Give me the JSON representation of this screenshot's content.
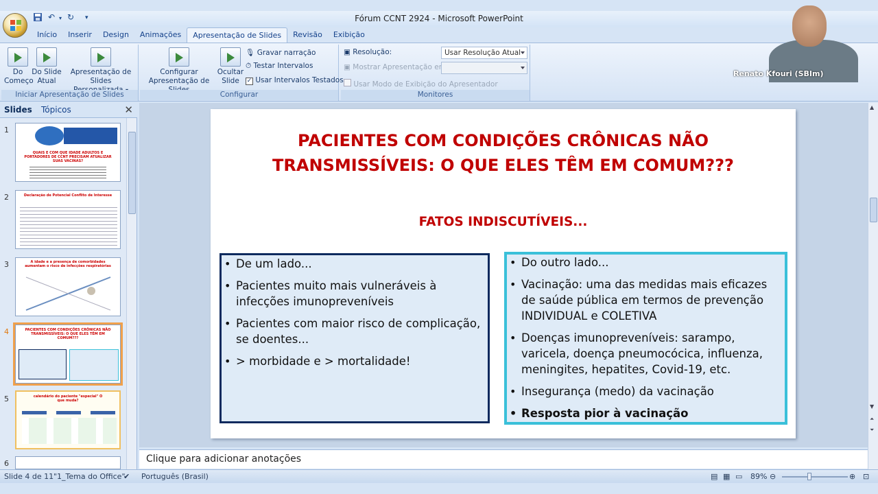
{
  "window": {
    "title": "Fórum CCNT 2924 - Microsoft PowerPoint"
  },
  "ribbon_tabs": [
    "Início",
    "Inserir",
    "Design",
    "Animações",
    "Apresentação de Slides",
    "Revisão",
    "Exibição"
  ],
  "ribbon": {
    "groups": {
      "start": {
        "label": "Iniciar Apresentação de Slides",
        "from_start_1": "Do",
        "from_start_2": "Começo",
        "from_current_1": "Do Slide",
        "from_current_2": "Atual",
        "custom_1": "Apresentação de",
        "custom_2": "Slides Personalizada"
      },
      "setup": {
        "label": "Configurar",
        "configure_1": "Configurar",
        "configure_2": "Apresentação de Slides",
        "hide_1": "Ocultar",
        "hide_2": "Slide",
        "record": "Gravar narração",
        "rehearse": "Testar Intervalos",
        "use_timings": "Usar Intervalos Testados"
      },
      "monitors": {
        "label": "Monitores",
        "resolution_label": "Resolução:",
        "resolution_value": "Usar Resolução Atual",
        "show_on_label": "Mostrar Apresentação em:",
        "presenter_view": "Usar Modo de Exibição do Apresentador"
      }
    }
  },
  "left_pane": {
    "tabs": [
      "Slides",
      "Tópicos"
    ],
    "thumbnails": [
      {
        "num": "1",
        "text": "QUAIS E COM QUE IDADE ADULTOS E PORTADORES DE CCNT PRECISAM ATUALIZAR SUAS VACINAS?"
      },
      {
        "num": "2",
        "text": "Declaração de Potencial Conflito de Interesse"
      },
      {
        "num": "3",
        "text": "A idade e a presença de comorbidades aumentam o risco de infecções respiratórias"
      },
      {
        "num": "4",
        "text": "PACIENTES COM CONDIÇÕES CRÔNICAS NÃO TRANSMISSÍVEIS: O QUE ELES TÊM EM COMUM???"
      },
      {
        "num": "5",
        "text": "calendário do paciente \"especial\" O que muda?"
      },
      {
        "num": "6",
        "text": ""
      }
    ]
  },
  "slide": {
    "title_line1": "PACIENTES COM CONDIÇÕES CRÔNICAS NÃO",
    "title_line2": "TRANSMISSÍVEIS: O QUE ELES TÊM EM COMUM???",
    "subtitle": "FATOS INDISCUTÍVEIS...",
    "left_box": [
      "De um lado...",
      "Pacientes muito mais vulneráveis à infecções imunopreveníveis",
      "Pacientes com maior risco de complicação, se doentes...",
      "> morbidade e > mortalidade!"
    ],
    "right_box": [
      "Do outro lado...",
      "Vacinação: uma das medidas mais eficazes de saúde pública em termos de prevenção INDIVIDUAL e COLETIVA",
      "Doenças imunopreveníveis: sarampo, varicela, doença pneumocócica, influenza, meningites, hepatites, Covid-19,  etc.",
      "Insegurança (medo) da vacinação",
      "Resposta pior à vacinação"
    ]
  },
  "notes_placeholder": "Clique para adicionar anotações",
  "status": {
    "slide_of": "Slide 4 de 11",
    "theme": "\"1_Tema do Office\"",
    "language": "Português (Brasil)",
    "zoom": "89%"
  },
  "webcam": {
    "name": "Renato Kfouri (SBIm)"
  },
  "colors": {
    "slide_title": "#c00000",
    "left_border": "#0d2a5e",
    "right_border": "#3ac0d9",
    "box_fill": "#dfebf7"
  }
}
